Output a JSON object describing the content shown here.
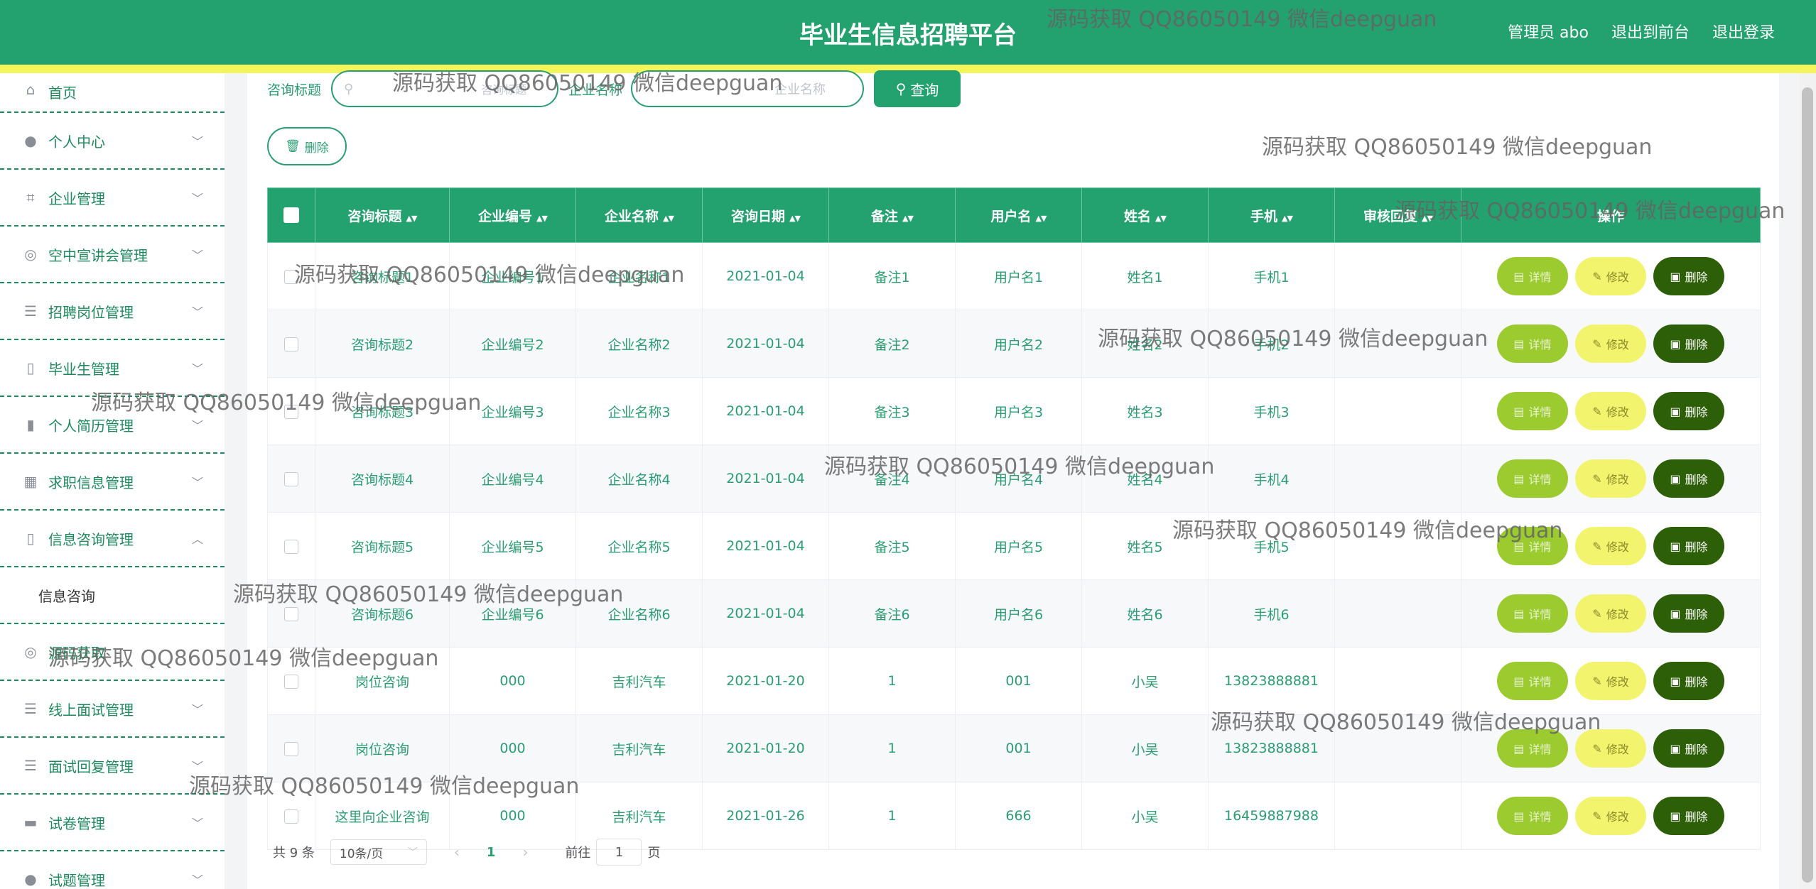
{
  "header": {
    "title": "毕业生信息招聘平台",
    "admin": "管理员 abo",
    "to_front": "退出到前台",
    "logout": "退出登录"
  },
  "sidebar": {
    "items": [
      {
        "label": "首页",
        "icon": "home-icon"
      },
      {
        "label": "个人中心",
        "icon": "user-icon"
      },
      {
        "label": "企业管理",
        "icon": "crop-icon"
      },
      {
        "label": "空中宣讲会管理",
        "icon": "circle-icon"
      },
      {
        "label": "招聘岗位管理",
        "icon": "sliders-icon"
      },
      {
        "label": "毕业生管理",
        "icon": "microphone-icon"
      },
      {
        "label": "个人简历管理",
        "icon": "bar-chart-icon"
      },
      {
        "label": "求职信息管理",
        "icon": "grid-icon"
      },
      {
        "label": "信息咨询管理",
        "icon": "microphone-icon"
      },
      {
        "label": "信息咨询",
        "icon": ""
      },
      {
        "label": "源码获取",
        "icon": "circle-icon"
      },
      {
        "label": "线上面试管理",
        "icon": "list-icon"
      },
      {
        "label": "面试回复管理",
        "icon": "list-icon"
      },
      {
        "label": "试卷管理",
        "icon": "monitor-icon"
      },
      {
        "label": "试题管理",
        "icon": "user-icon"
      }
    ]
  },
  "search": {
    "title_label": "咨询标题",
    "title_placeholder": "咨询标题",
    "company_label": "企业名称",
    "company_placeholder": "企业名称",
    "button": "查询"
  },
  "toolbar": {
    "delete_label": "删除"
  },
  "table": {
    "headers": [
      "咨询标题",
      "企业编号",
      "企业名称",
      "咨询日期",
      "备注",
      "用户名",
      "姓名",
      "手机",
      "审核回复",
      "操作"
    ],
    "rows": [
      [
        "咨询标题1",
        "企业编号1",
        "企业名称1",
        "2021-01-04",
        "备注1",
        "用户名1",
        "姓名1",
        "手机1",
        ""
      ],
      [
        "咨询标题2",
        "企业编号2",
        "企业名称2",
        "2021-01-04",
        "备注2",
        "用户名2",
        "姓名2",
        "手机2",
        ""
      ],
      [
        "咨询标题3",
        "企业编号3",
        "企业名称3",
        "2021-01-04",
        "备注3",
        "用户名3",
        "姓名3",
        "手机3",
        ""
      ],
      [
        "咨询标题4",
        "企业编号4",
        "企业名称4",
        "2021-01-04",
        "备注4",
        "用户名4",
        "姓名4",
        "手机4",
        ""
      ],
      [
        "咨询标题5",
        "企业编号5",
        "企业名称5",
        "2021-01-04",
        "备注5",
        "用户名5",
        "姓名5",
        "手机5",
        ""
      ],
      [
        "咨询标题6",
        "企业编号6",
        "企业名称6",
        "2021-01-04",
        "备注6",
        "用户名6",
        "姓名6",
        "手机6",
        ""
      ],
      [
        "岗位咨询",
        "000",
        "吉利汽车",
        "2021-01-20",
        "1",
        "001",
        "小吴",
        "13823888881",
        ""
      ],
      [
        "岗位咨询",
        "000",
        "吉利汽车",
        "2021-01-20",
        "1",
        "001",
        "小吴",
        "13823888881",
        ""
      ],
      [
        "这里向企业咨询",
        "000",
        "吉利汽车",
        "2021-01-26",
        "1",
        "666",
        "小吴",
        "16459887988",
        ""
      ]
    ],
    "actions": {
      "detail": "详情",
      "edit": "修改",
      "delete": "删除"
    }
  },
  "pager": {
    "total": "共 9 条",
    "page_size": "10条/页",
    "current": "1",
    "goto_prefix": "前往",
    "goto_value": "1",
    "goto_suffix": "页"
  },
  "watermark": "源码获取 QQ86050149 微信deepguan"
}
